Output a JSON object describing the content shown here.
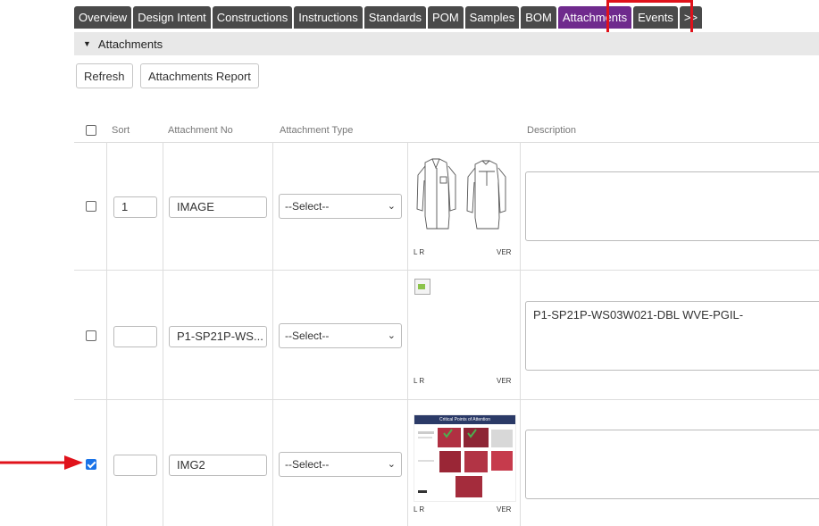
{
  "tabs": [
    "Overview",
    "Design Intent",
    "Constructions",
    "Instructions",
    "Standards",
    "POM",
    "Samples",
    "BOM",
    "Attachments",
    "Events",
    ">>"
  ],
  "active_tab": "Attachments",
  "section": {
    "title": "Attachments"
  },
  "toolbar": {
    "refresh": "Refresh",
    "report": "Attachments Report"
  },
  "columns": {
    "sort": "Sort",
    "attachment_no": "Attachment No",
    "attachment_type": "Attachment Type",
    "description": "Description"
  },
  "rows": [
    {
      "checked": false,
      "sort": "1",
      "attachment_no": "IMAGE",
      "attachment_type": "--Select--",
      "thumb_left": "L R",
      "thumb_right": "VER",
      "description": ""
    },
    {
      "checked": false,
      "sort": "",
      "attachment_no": "P1-SP21P-WS...",
      "attachment_type": "--Select--",
      "thumb_left": "L R",
      "thumb_right": "VER",
      "description": "P1-SP21P-WS03W021-DBL WVE-PGIL-"
    },
    {
      "checked": true,
      "sort": "",
      "attachment_no": "IMG2",
      "attachment_type": "--Select--",
      "thumb_left": "L R",
      "thumb_right": "VER",
      "description": ""
    }
  ],
  "thumb3": {
    "header": "Critical Points of Attention"
  },
  "colors": {
    "active_tab": "#6f2a8d",
    "tab": "#4a4a4a",
    "highlight": "#e0121b",
    "checkbox": "#1a73e8"
  }
}
